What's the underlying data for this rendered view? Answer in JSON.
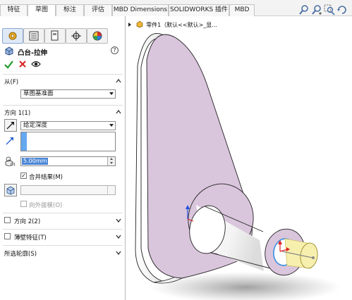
{
  "tabs": [
    "特征",
    "草图",
    "标注",
    "评估",
    "MBD Dimensions",
    "SOLIDWORKS 插件",
    "MBD"
  ],
  "active_tab": "草图",
  "tool_icons": [
    "search-icon",
    "search-plus-icon",
    "zoom-area-icon",
    "rotate-view-icon"
  ],
  "panel": {
    "tab_icons": [
      "feature-manager-icon",
      "property-manager-icon",
      "configuration-manager-icon",
      "dimxpert-icon",
      "display-manager-icon"
    ],
    "feature_title": "凸台-拉伸",
    "help_glyph": "?",
    "from_section": {
      "title": "从(F)",
      "value": "草图基准面"
    },
    "direction1": {
      "title": "方向 1(1)",
      "end_condition": "给定深度",
      "depth": "5.00mm",
      "merge_result_label": "合并结果(M)",
      "merge_result_checked": true,
      "draft_outward_label": "向外拔模(O)",
      "draft_outward_checked": false
    },
    "direction2": {
      "title": "方向 2(2)",
      "checked": false
    },
    "thin_feature": {
      "title": "薄壁特征(T)",
      "checked": false
    },
    "selected_contours": {
      "title": "所选轮廓(S)"
    }
  },
  "graphics": {
    "tree_text": "零件1（默认<<默认>_显...",
    "colors": {
      "plate_face": "#d9c5dc",
      "edge": "#222222",
      "selected_circle": "#3a8fe0",
      "preview_cylinder": "#f7efae",
      "axis_x": "#e02020",
      "axis_y": "#2050e0"
    }
  }
}
